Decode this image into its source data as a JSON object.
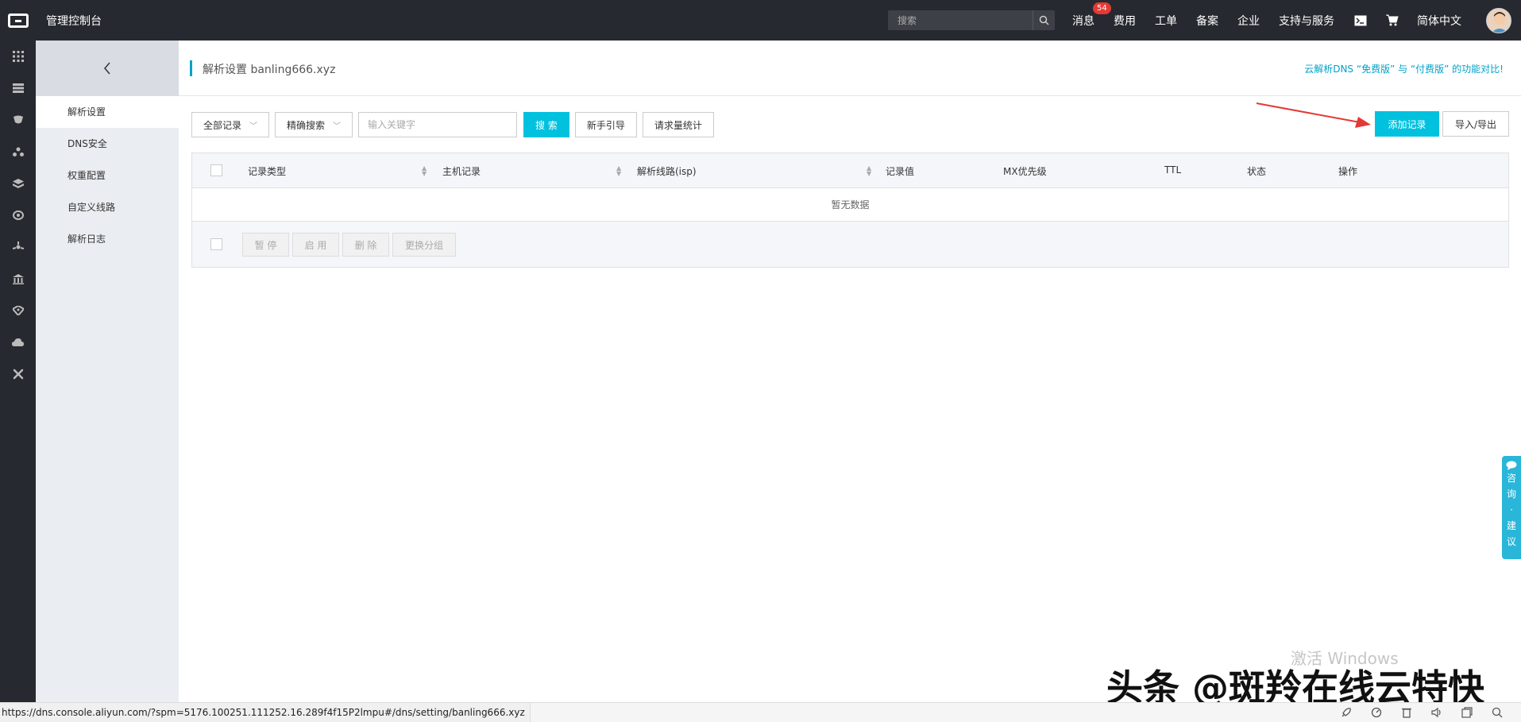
{
  "topbar": {
    "console_title": "管理控制台",
    "search_placeholder": "搜索",
    "nav": {
      "messages": "消息",
      "messages_count": "54",
      "billing": "费用",
      "tickets": "工单",
      "icp": "备案",
      "enterprise": "企业",
      "support": "支持与服务",
      "language": "简体中文"
    }
  },
  "subsidebar": {
    "items": [
      "解析设置",
      "DNS安全",
      "权重配置",
      "自定义线路",
      "解析日志"
    ],
    "active_index": 0
  },
  "page": {
    "title": "解析设置 banling666.xyz",
    "compare_link": "云解析DNS “免费版” 与 “付费版” 的功能对比!"
  },
  "toolbar": {
    "record_filter": "全部记录",
    "search_mode": "精确搜索",
    "keyword_placeholder": "输入关键字",
    "search_button": "搜 索",
    "guide_button": "新手引导",
    "stats_button": "请求量统计",
    "add_record_button": "添加记录",
    "import_export_button": "导入/导出"
  },
  "table": {
    "headers": [
      "记录类型",
      "主机记录",
      "解析线路(isp)",
      "记录值",
      "MX优先级",
      "TTL",
      "状态",
      "操作"
    ],
    "empty_text": "暂无数据",
    "bulk_actions": [
      "暂 停",
      "启 用",
      "删 除",
      "更换分组"
    ]
  },
  "float_tab": {
    "chars": [
      "咨",
      "询",
      "·",
      "建",
      "议"
    ]
  },
  "watermarks": {
    "windows": "激活 Windows",
    "toutiao": "头条 @斑羚在线云特快"
  },
  "status": {
    "url": "https://dns.console.aliyun.com/?spm=5176.100251.111252.16.289f4f15P2lmpu#/dns/setting/banling666.xyz"
  },
  "colors": {
    "accent": "#00c1de",
    "topbar_bg": "#26292f",
    "link": "#00a2ca",
    "badge": "#e53935"
  }
}
